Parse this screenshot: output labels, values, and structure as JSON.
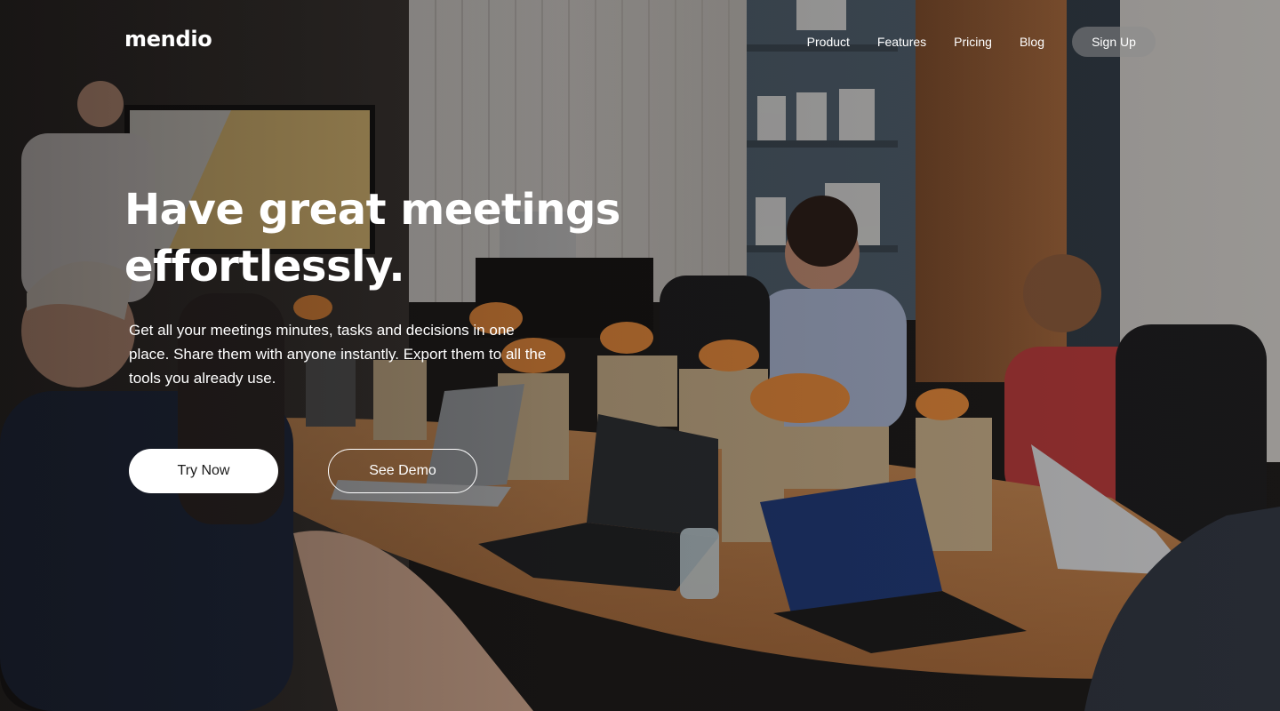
{
  "nav": {
    "logo": "mendio",
    "links": [
      {
        "label": "Product"
      },
      {
        "label": "Features"
      },
      {
        "label": "Pricing"
      },
      {
        "label": "Blog"
      }
    ],
    "signup_label": "Sign Up"
  },
  "hero": {
    "headline_line1": "Have great meetings",
    "headline_line2": "effortlessly.",
    "subtext": "Get all your meetings minutes, tasks and decisions in one place. Share them with anyone instantly. Export them to all the tools you already use.",
    "primary_cta": "Try Now",
    "secondary_cta": "See Demo"
  },
  "colors": {
    "text": "#ffffff",
    "primary_button_bg": "#ffffff",
    "primary_button_text": "#1a1a1a",
    "signup_button_bg": "rgba(140,140,140,0.55)"
  }
}
